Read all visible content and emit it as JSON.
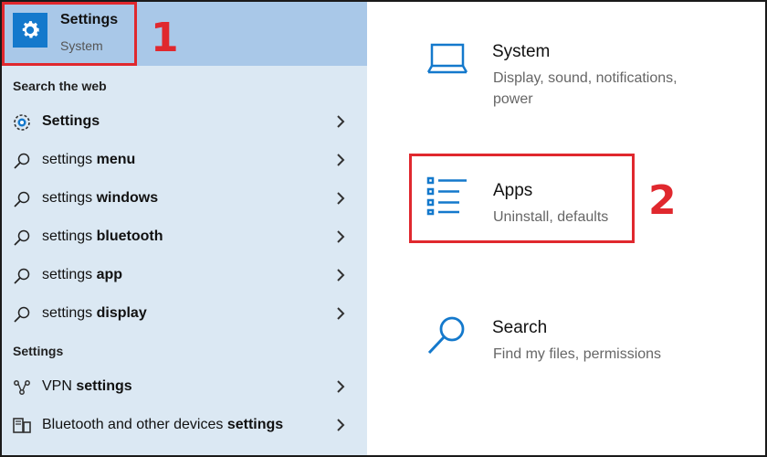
{
  "top_result": {
    "title": "Settings",
    "subtitle": "System"
  },
  "sections": {
    "web": "Search the web",
    "settings": "Settings"
  },
  "web_results": [
    {
      "prefix": "",
      "bold": "Settings",
      "icon": "settings-app-icon"
    },
    {
      "prefix": "settings ",
      "bold": "menu",
      "icon": "search-icon"
    },
    {
      "prefix": "settings ",
      "bold": "windows",
      "icon": "search-icon"
    },
    {
      "prefix": "settings ",
      "bold": "bluetooth",
      "icon": "search-icon"
    },
    {
      "prefix": "settings ",
      "bold": "app",
      "icon": "search-icon"
    },
    {
      "prefix": "settings ",
      "bold": "display",
      "icon": "search-icon"
    }
  ],
  "settings_results": [
    {
      "prefix": "VPN ",
      "bold": "settings",
      "icon": "vpn-icon"
    },
    {
      "prefix": "Bluetooth and other devices ",
      "bold": "settings",
      "icon": "devices-icon"
    }
  ],
  "cards": {
    "system": {
      "title": "System",
      "subtitle": "Display, sound, notifications, power"
    },
    "apps": {
      "title": "Apps",
      "subtitle": "Uninstall, defaults"
    },
    "search": {
      "title": "Search",
      "subtitle": "Find my files, permissions"
    }
  },
  "annotations": {
    "one": "1",
    "two": "2"
  },
  "colors": {
    "accent": "#1479cc",
    "highlight": "#e0282e",
    "panel": "#dbe8f3",
    "selected": "#a9c8e8"
  }
}
